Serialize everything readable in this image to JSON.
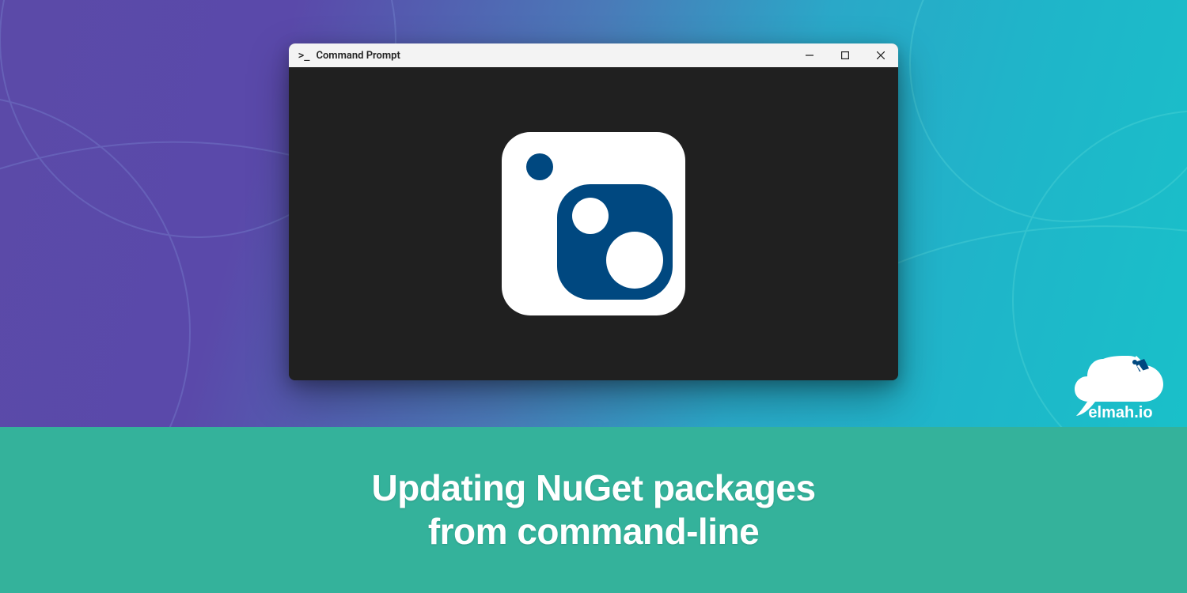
{
  "window": {
    "title": "Command Prompt",
    "controls": {
      "min": "minimize",
      "max": "maximize",
      "close": "close"
    }
  },
  "content": {
    "logo_name": "nuget-logo"
  },
  "brand": {
    "name": "elmah.io",
    "text": "elmah.io"
  },
  "colors": {
    "nuget_blue": "#004880",
    "terminal_bg": "#202020",
    "titlebar_bg": "#f3f3f3",
    "caption_band": "#34b29b",
    "gradient_start": "#5b4aa8",
    "gradient_end": "#18c2c9"
  },
  "caption": {
    "line1": "Updating NuGet packages",
    "line2": "from command-line"
  }
}
